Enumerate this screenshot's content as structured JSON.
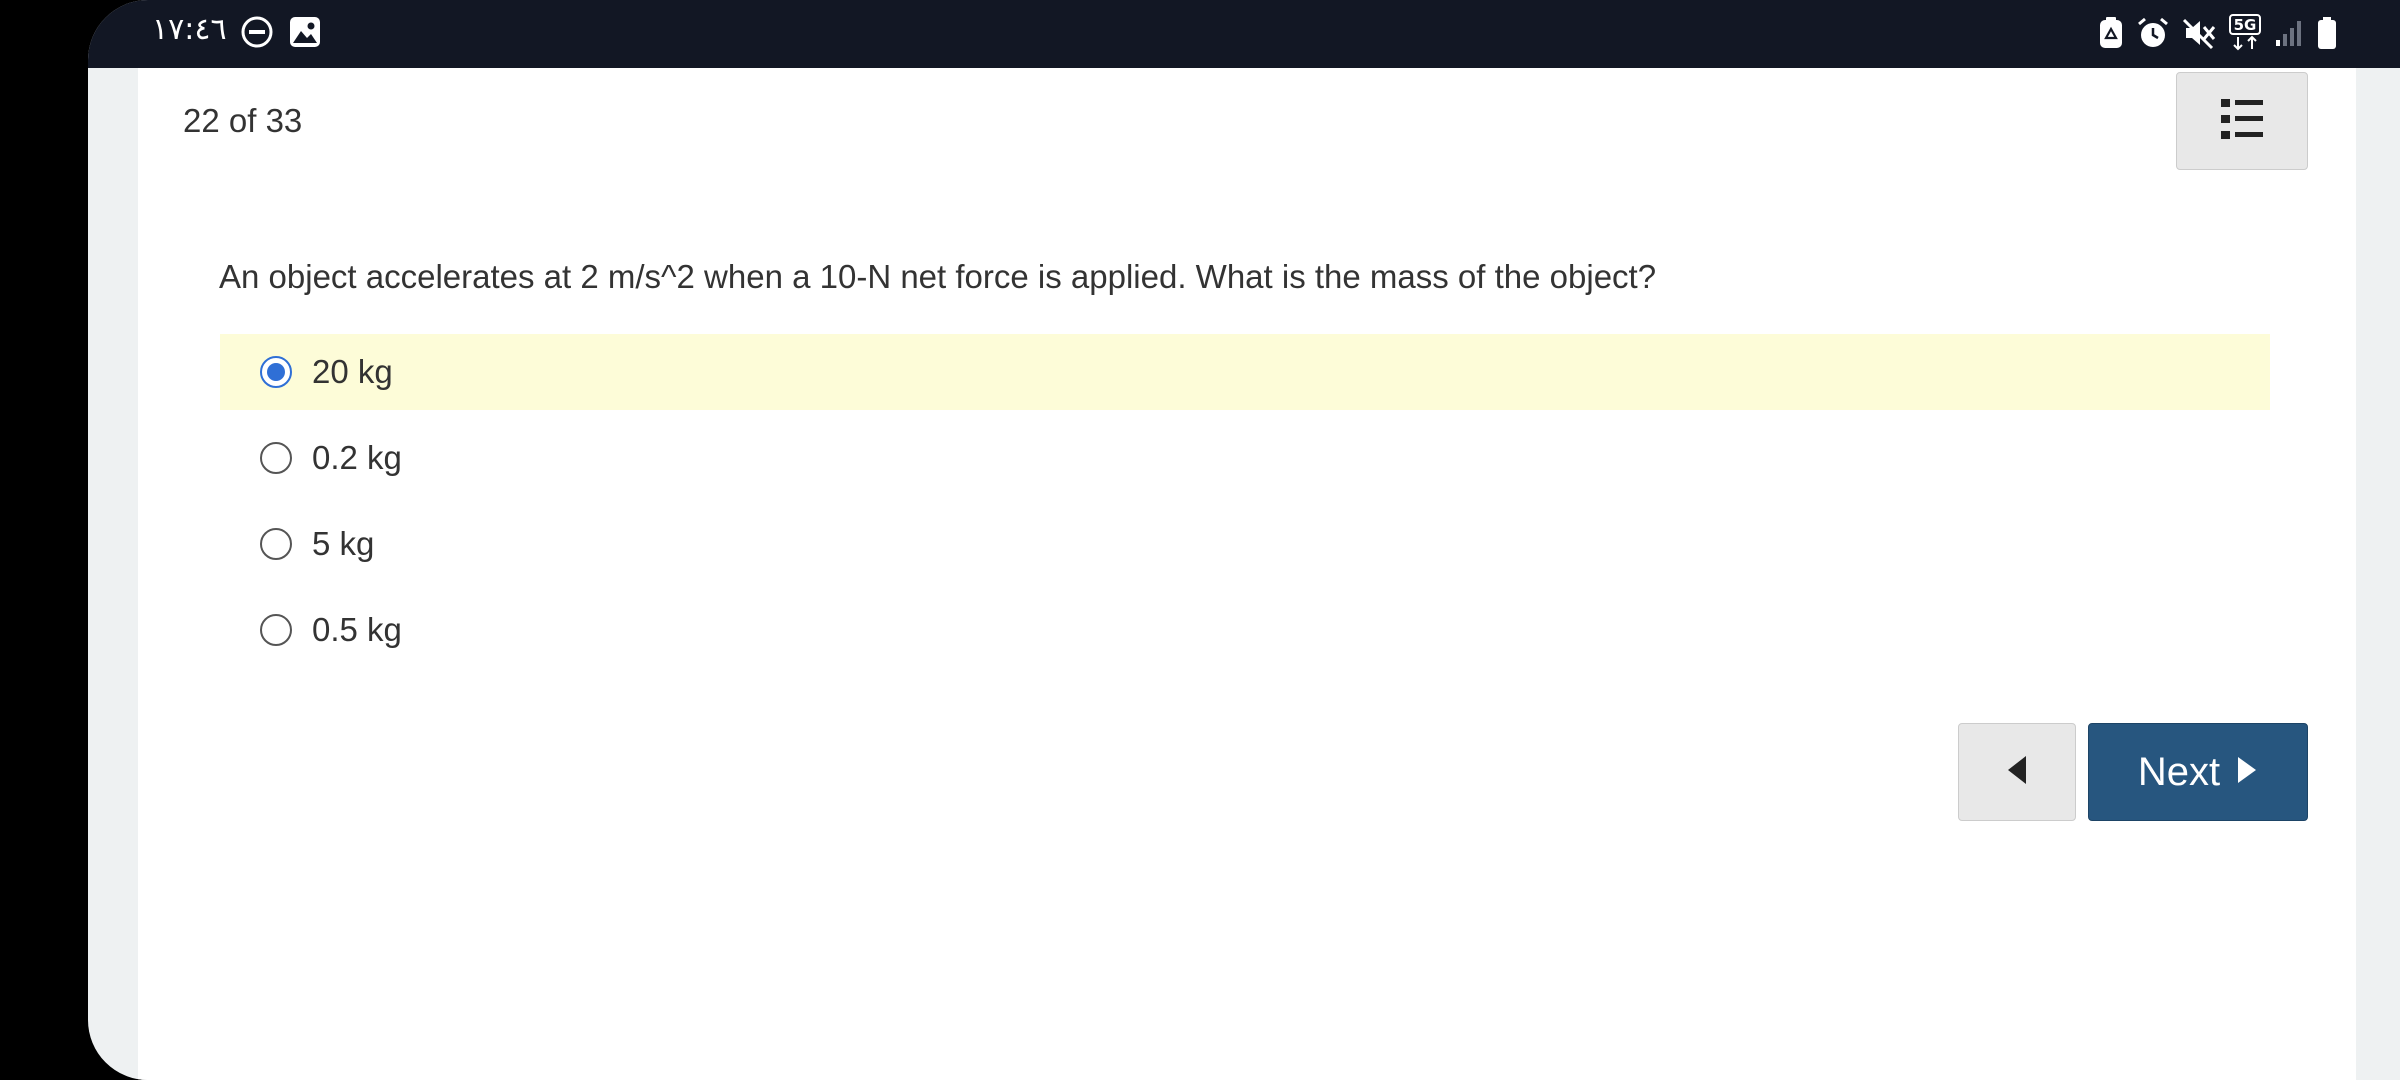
{
  "status_bar": {
    "time": "١٧:٤٦",
    "left_icons": [
      "do-not-disturb-icon",
      "gallery-icon"
    ],
    "right_icons": [
      "recycle-icon",
      "alarm-icon",
      "mute-icon",
      "5g-icon",
      "signal-icon",
      "battery-icon"
    ],
    "network_label": "5G"
  },
  "quiz": {
    "progress": "22 of 33",
    "question": "An object accelerates at 2 m/s^2 when a 10-N net force is applied. What is the mass of the object?",
    "options": [
      {
        "label": "20 kg",
        "selected": true
      },
      {
        "label": "0.2 kg",
        "selected": false
      },
      {
        "label": "5 kg",
        "selected": false
      },
      {
        "label": "0.5 kg",
        "selected": false
      }
    ]
  },
  "navigation": {
    "next_label": "Next"
  },
  "colors": {
    "status_bar_bg": "#121724",
    "selected_option_bg": "#fdfcd8",
    "radio_selected": "#2f6fd6",
    "next_button_bg": "#27567f"
  }
}
